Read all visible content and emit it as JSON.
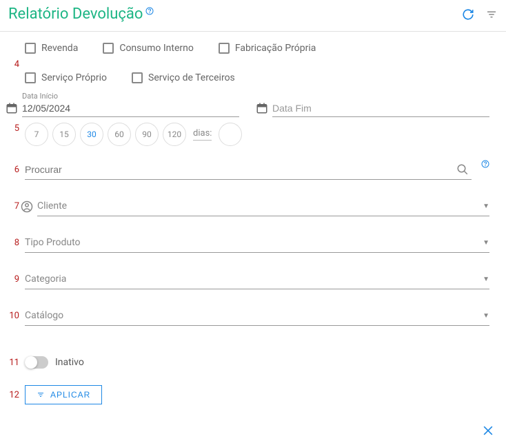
{
  "header": {
    "title": "Relatório Devolução"
  },
  "numbers": {
    "n4": "4",
    "n5": "5",
    "n6": "6",
    "n7": "7",
    "n8": "8",
    "n9": "9",
    "n10": "10",
    "n11": "11",
    "n12": "12"
  },
  "checkboxes": {
    "revenda": "Revenda",
    "consumo": "Consumo Interno",
    "fabricacao": "Fabricação Própria",
    "servico_proprio": "Serviço Próprio",
    "servico_terceiros": "Serviço de Terceiros"
  },
  "dates": {
    "inicio_label": "Data Início",
    "inicio_value": "12/05/2024",
    "fim_label": "Data Fim",
    "fim_value": ""
  },
  "chips": {
    "c7": "7",
    "c15": "15",
    "c30": "30",
    "c60": "60",
    "c90": "90",
    "c120": "120",
    "dias": "dias:"
  },
  "search": {
    "placeholder": "Procurar"
  },
  "selects": {
    "cliente": "Cliente",
    "tipo_produto": "Tipo Produto",
    "categoria": "Categoria",
    "catalogo": "Catálogo"
  },
  "toggle": {
    "label": "Inativo"
  },
  "apply": {
    "label": "APLICAR"
  }
}
